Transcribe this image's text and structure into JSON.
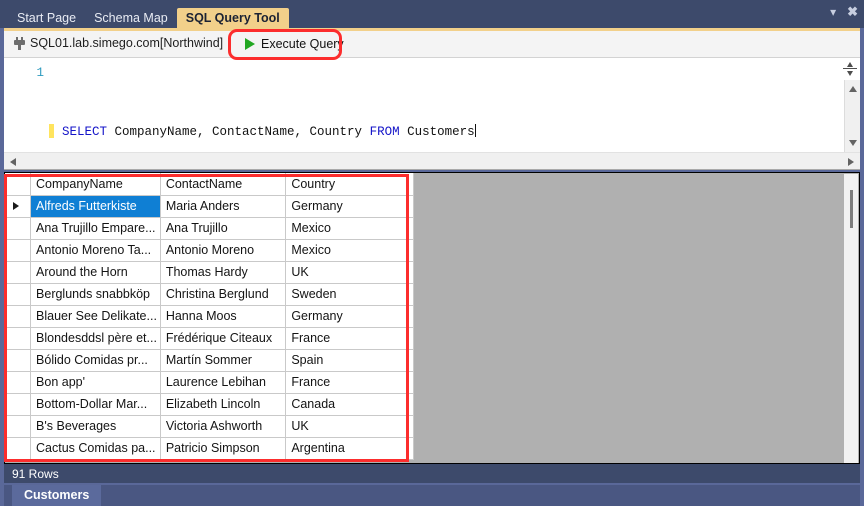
{
  "window": {
    "tabs": [
      {
        "label": "Start Page",
        "active": false
      },
      {
        "label": "Schema Map",
        "active": false
      },
      {
        "label": "SQL Query Tool",
        "active": true
      }
    ],
    "controls": {
      "chevron_down": "▾",
      "close": "✖"
    }
  },
  "toolbar": {
    "connection_icon": "plug-icon",
    "connection_label": "SQL01.lab.simego.com[Northwind]",
    "execute_icon": "play-triangle-icon",
    "execute_label": "Execute Query"
  },
  "editor": {
    "line_number": "1",
    "query": "SELECT CompanyName, ContactName, Country FROM Customers",
    "tokens": {
      "kw_select": "SELECT",
      "mid": " CompanyName, ContactName, Country ",
      "kw_from": "FROM",
      "tail": " Customers"
    },
    "keyword_color": "#1414c8",
    "line_number_color": "#2e9bbf",
    "marker_color": "#ffe45e"
  },
  "grid": {
    "columns": [
      "CompanyName",
      "ContactName",
      "Country"
    ],
    "selected_row_index": 0,
    "selection_color": "#0f7fd4",
    "rows": [
      {
        "company": "Alfreds Futterkiste",
        "contact": "Maria Anders",
        "country": "Germany"
      },
      {
        "company": "Ana Trujillo Empare...",
        "contact": "Ana Trujillo",
        "country": "Mexico"
      },
      {
        "company": "Antonio Moreno Ta...",
        "contact": "Antonio Moreno",
        "country": "Mexico"
      },
      {
        "company": "Around the Horn",
        "contact": "Thomas Hardy",
        "country": "UK"
      },
      {
        "company": "Berglunds snabbköp",
        "contact": "Christina Berglund",
        "country": "Sweden"
      },
      {
        "company": "Blauer See Delikate...",
        "contact": "Hanna Moos",
        "country": "Germany"
      },
      {
        "company": "Blondesddsl père et...",
        "contact": "Frédérique Citeaux",
        "country": "France"
      },
      {
        "company": "Bólido Comidas pr...",
        "contact": "Martín Sommer",
        "country": "Spain"
      },
      {
        "company": "Bon app'",
        "contact": "Laurence Lebihan",
        "country": "France"
      },
      {
        "company": "Bottom-Dollar Mar...",
        "contact": "Elizabeth Lincoln",
        "country": "Canada"
      },
      {
        "company": "B's Beverages",
        "contact": "Victoria Ashworth",
        "country": "UK"
      },
      {
        "company": "Cactus Comidas pa...",
        "contact": "Patricio Simpson",
        "country": "Argentina"
      }
    ]
  },
  "status": {
    "row_count_label": "91 Rows"
  },
  "bottom": {
    "tab_label": "Customers"
  },
  "annotations": {
    "highlight_color": "#fc2d2d"
  }
}
